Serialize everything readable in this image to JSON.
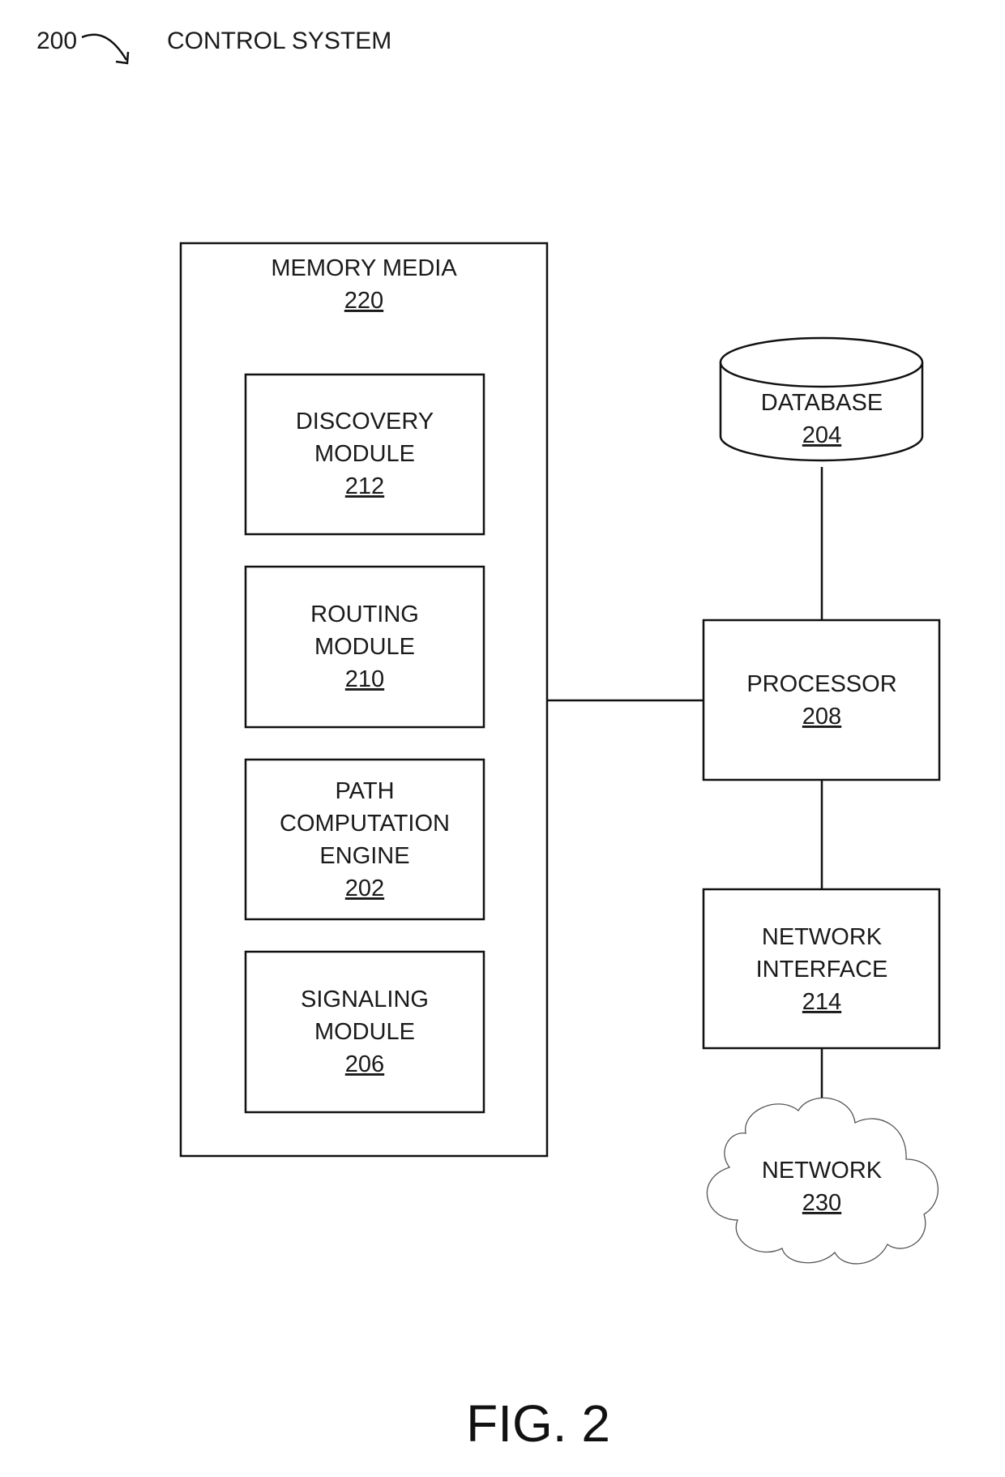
{
  "header": {
    "ref_number": "200",
    "title": "CONTROL SYSTEM"
  },
  "memory_media": {
    "label": "MEMORY MEDIA",
    "number": "220",
    "modules": [
      {
        "lines": [
          "DISCOVERY",
          "MODULE"
        ],
        "number": "212"
      },
      {
        "lines": [
          "ROUTING",
          "MODULE"
        ],
        "number": "210"
      },
      {
        "lines": [
          "PATH",
          "COMPUTATION",
          "ENGINE"
        ],
        "number": "202"
      },
      {
        "lines": [
          "SIGNALING",
          "MODULE"
        ],
        "number": "206"
      }
    ]
  },
  "database": {
    "label": "DATABASE",
    "number": "204"
  },
  "processor": {
    "label": "PROCESSOR",
    "number": "208"
  },
  "network_interface": {
    "lines": [
      "NETWORK",
      "INTERFACE"
    ],
    "number": "214"
  },
  "network": {
    "label": "NETWORK",
    "number": "230"
  },
  "figure_caption": "FIG. 2"
}
